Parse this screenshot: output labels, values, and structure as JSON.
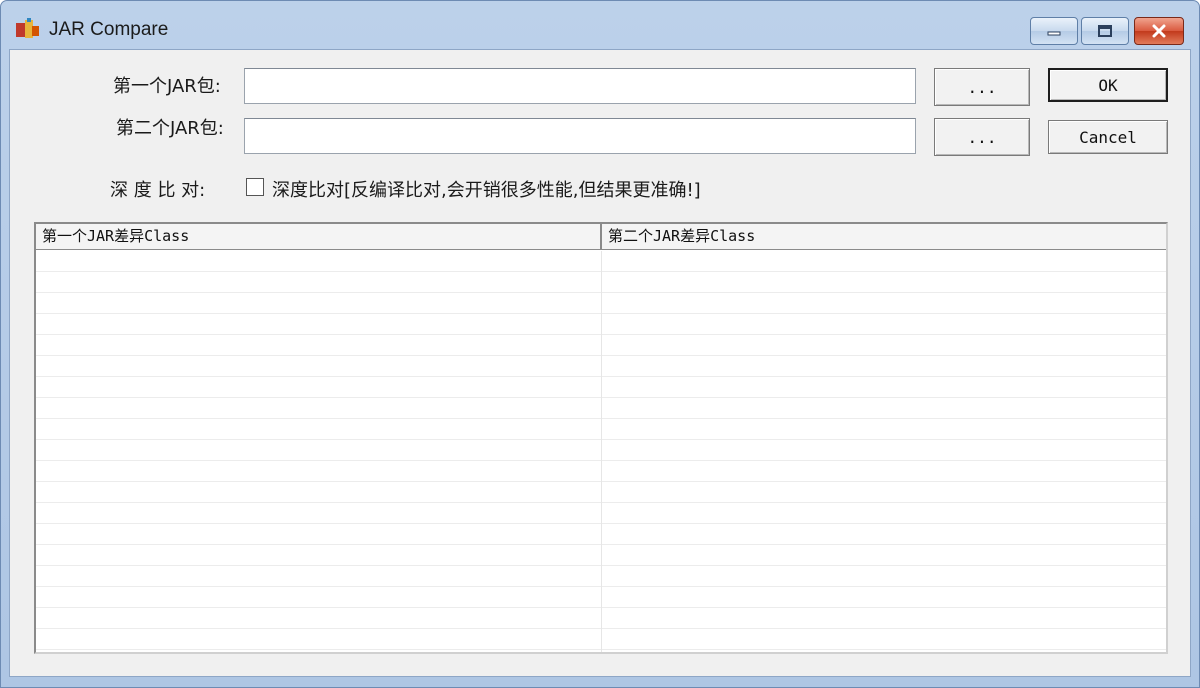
{
  "window": {
    "title": "JAR Compare",
    "app_icon": "jar-app-icon",
    "controls": {
      "minimize": "minimize-icon",
      "maximize": "maximize-icon",
      "close": "close-icon"
    }
  },
  "form": {
    "first_jar": {
      "label": "第一个JAR包:",
      "value": "",
      "browse_label": "..."
    },
    "second_jar": {
      "label": "第二个JAR包:",
      "value": "",
      "browse_label": "..."
    },
    "deep_compare": {
      "label": "深 度 比 对:",
      "checkbox_text": "深度比对[反编译比对,会开销很多性能,但结果更准确!]",
      "checked": false
    },
    "ok_label": "OK",
    "cancel_label": "Cancel"
  },
  "result_list": {
    "columns": [
      "第一个JAR差异Class",
      "第二个JAR差异Class"
    ],
    "rows": []
  },
  "colors": {
    "titlebar": "#bcd1ea",
    "client_bg": "#f0f0f0",
    "close_button": "#c9472a"
  }
}
